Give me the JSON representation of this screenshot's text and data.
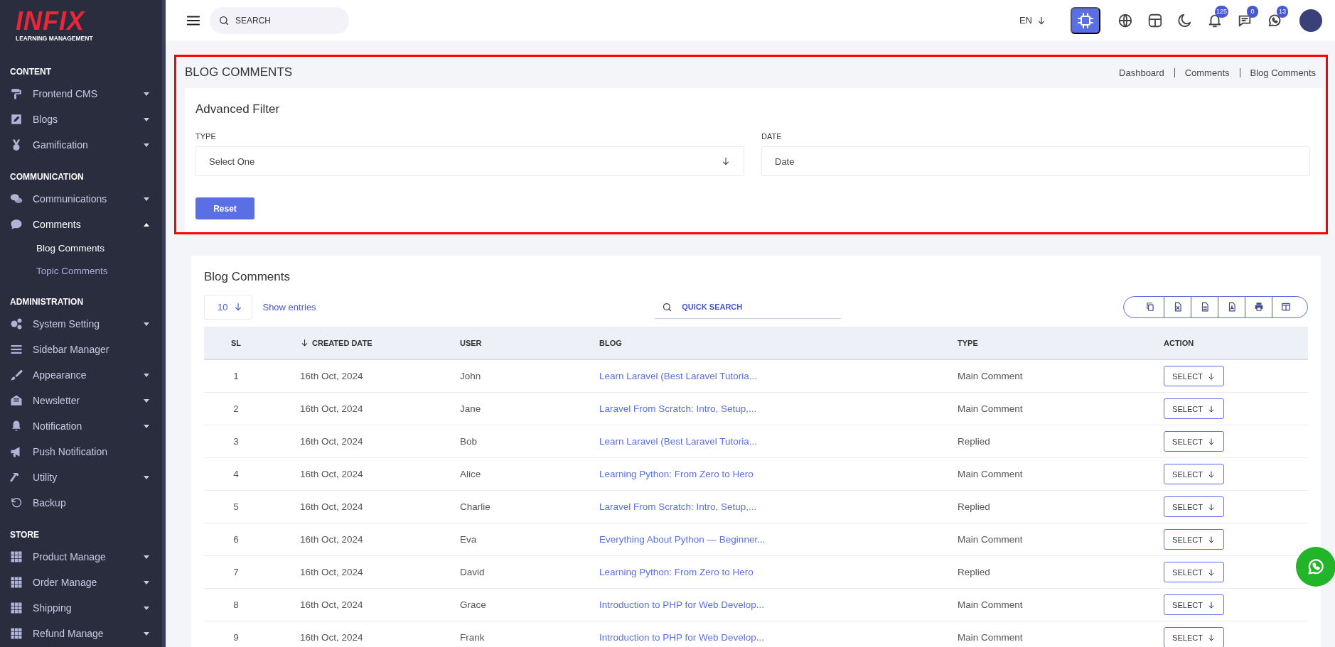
{
  "sidebar": {
    "logo": {
      "wordmark": "INFIX",
      "tagline": "LEARNING MANAGEMENT"
    },
    "sections": [
      {
        "title": "CONTENT",
        "items": [
          {
            "label": "Frontend CMS",
            "expanded": false,
            "selected": false
          },
          {
            "label": "Blogs",
            "expanded": false,
            "selected": false
          },
          {
            "label": "Gamification",
            "expanded": false,
            "selected": false
          }
        ]
      },
      {
        "title": "COMMUNICATION",
        "items": [
          {
            "label": "Communications",
            "expanded": false,
            "selected": false
          },
          {
            "label": "Comments",
            "expanded": true,
            "selected": true,
            "children": [
              {
                "label": "Blog Comments",
                "selected": true
              },
              {
                "label": "Topic Comments",
                "selected": false
              }
            ]
          }
        ]
      },
      {
        "title": "ADMINISTRATION",
        "items": [
          {
            "label": "System Setting",
            "expanded": false,
            "selected": false
          },
          {
            "label": "Sidebar Manager",
            "selected": false
          },
          {
            "label": "Appearance",
            "expanded": false,
            "selected": false
          },
          {
            "label": "Newsletter",
            "expanded": false,
            "selected": false
          },
          {
            "label": "Notification",
            "expanded": false,
            "selected": false
          },
          {
            "label": "Push Notification",
            "selected": false
          },
          {
            "label": "Utility",
            "expanded": false,
            "selected": false
          },
          {
            "label": "Backup",
            "selected": false
          }
        ]
      },
      {
        "title": "STORE",
        "items": [
          {
            "label": "Product Manage",
            "expanded": false,
            "selected": false
          },
          {
            "label": "Order Manage",
            "expanded": false,
            "selected": false
          },
          {
            "label": "Shipping",
            "expanded": false,
            "selected": false
          },
          {
            "label": "Refund Manage",
            "expanded": false,
            "selected": false
          }
        ]
      }
    ]
  },
  "topbar": {
    "search": {
      "placeholder": "SEARCH"
    },
    "language": "EN",
    "badges": {
      "notifications": "125",
      "messages": "0",
      "whatsapp": "13"
    }
  },
  "page_header": {
    "title": "BLOG COMMENTS",
    "breadcrumb": [
      "Dashboard",
      "Comments",
      "Blog Comments"
    ]
  },
  "filter": {
    "title": "Advanced Filter",
    "type_label": "TYPE",
    "type_value": "Select One",
    "date_label": "DATE",
    "date_placeholder": "Date",
    "reset": "Reset"
  },
  "table_card": {
    "title": "Blog Comments",
    "page_size": "10",
    "show_entries": "Show entries",
    "quick_search": {
      "placeholder": "QUICK SEARCH"
    },
    "columns": [
      {
        "label": "SL",
        "sorted": false
      },
      {
        "label": "CREATED DATE",
        "sorted": true
      },
      {
        "label": "USER",
        "sorted": false
      },
      {
        "label": "BLOG",
        "sorted": false
      },
      {
        "label": "TYPE",
        "sorted": false
      },
      {
        "label": "ACTION",
        "sorted": false
      }
    ],
    "rows": [
      {
        "sl": "1",
        "date": "16th Oct, 2024",
        "user": "John",
        "blog": "Learn Laravel (Best Laravel Tutoria...",
        "type": "Main Comment",
        "action": "SELECT"
      },
      {
        "sl": "2",
        "date": "16th Oct, 2024",
        "user": "Jane",
        "blog": "Laravel From Scratch: Intro, Setup,...",
        "type": "Main Comment",
        "action": "SELECT"
      },
      {
        "sl": "3",
        "date": "16th Oct, 2024",
        "user": "Bob",
        "blog": "Learn Laravel (Best Laravel Tutoria...",
        "type": "Replied",
        "action": "SELECT"
      },
      {
        "sl": "4",
        "date": "16th Oct, 2024",
        "user": "Alice",
        "blog": "Learning Python: From Zero to Hero",
        "type": "Main Comment",
        "action": "SELECT"
      },
      {
        "sl": "5",
        "date": "16th Oct, 2024",
        "user": "Charlie",
        "blog": "Laravel From Scratch: Intro, Setup,...",
        "type": "Replied",
        "action": "SELECT"
      },
      {
        "sl": "6",
        "date": "16th Oct, 2024",
        "user": "Eva",
        "blog": "Everything About Python — Beginner...",
        "type": "Main Comment",
        "action": "SELECT"
      },
      {
        "sl": "7",
        "date": "16th Oct, 2024",
        "user": "David",
        "blog": "Learning Python: From Zero to Hero",
        "type": "Replied",
        "action": "SELECT"
      },
      {
        "sl": "8",
        "date": "16th Oct, 2024",
        "user": "Grace",
        "blog": "Introduction to PHP for Web Develop...",
        "type": "Main Comment",
        "action": "SELECT"
      },
      {
        "sl": "9",
        "date": "16th Oct, 2024",
        "user": "Frank",
        "blog": "Introduction to PHP for Web Develop...",
        "type": "Main Comment",
        "action": "SELECT"
      }
    ]
  }
}
